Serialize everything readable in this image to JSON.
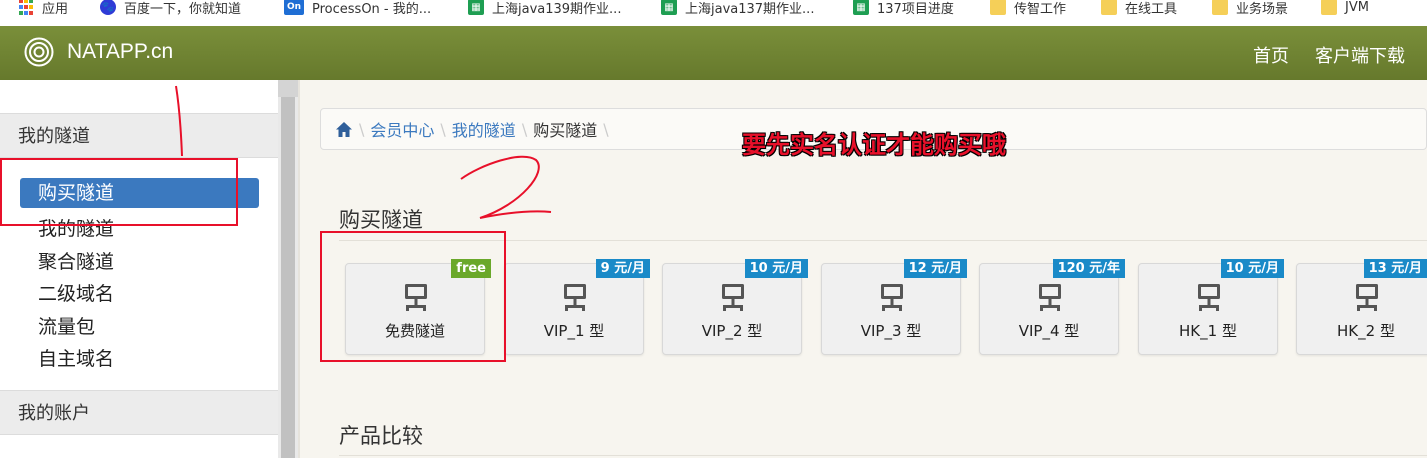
{
  "bookmarks": [
    {
      "label": "应用",
      "icon": "apps-icon"
    },
    {
      "label": "百度一下，你就知道",
      "icon": "baidu-icon"
    },
    {
      "label": "ProcessOn - 我的...",
      "icon": "processon-icon",
      "icon_text": "On"
    },
    {
      "label": "上海java139期作业...",
      "icon": "sheet-icon"
    },
    {
      "label": "上海java137期作业...",
      "icon": "sheet-icon"
    },
    {
      "label": "137项目进度",
      "icon": "sheet-icon"
    },
    {
      "label": "传智工作",
      "icon": "folder-icon"
    },
    {
      "label": "在线工具",
      "icon": "folder-icon"
    },
    {
      "label": "业务场景",
      "icon": "folder-icon"
    },
    {
      "label": "JVM",
      "icon": "folder-icon"
    }
  ],
  "header": {
    "brand": "NATAPP.cn",
    "nav": [
      "首页",
      "客户端下载"
    ],
    "color": "#6f8432"
  },
  "sidebar": {
    "sections": [
      {
        "title": "我的隧道",
        "items": [
          "购买隧道",
          "我的隧道",
          "聚合隧道",
          "二级域名",
          "流量包",
          "自主域名"
        ],
        "active": "购买隧道"
      },
      {
        "title": "我的账户"
      }
    ],
    "active_color": "#3b79bf"
  },
  "breadcrumb": {
    "home_icon": "home-icon",
    "items": [
      "会员中心",
      "我的隧道",
      "购买隧道"
    ]
  },
  "annotation": {
    "text": "要先实名认证才能购买哦",
    "marks": [
      "1",
      "2"
    ],
    "color": "#e8102a"
  },
  "main": {
    "buy_title": "购买隧道",
    "compare_title": "产品比较",
    "plans": [
      {
        "label": "免费隧道",
        "price": "free"
      },
      {
        "label": "VIP_1 型",
        "price": "9 元/月"
      },
      {
        "label": "VIP_2 型",
        "price": "10 元/月"
      },
      {
        "label": "VIP_3 型",
        "price": "12 元/月"
      },
      {
        "label": "VIP_4 型",
        "price": "120 元/年"
      },
      {
        "label": "HK_1 型",
        "price": "10 元/月"
      },
      {
        "label": "HK_2 型",
        "price": "13 元/月"
      }
    ],
    "price_color": "#1a8ac8",
    "free_color": "#6aa82a"
  }
}
